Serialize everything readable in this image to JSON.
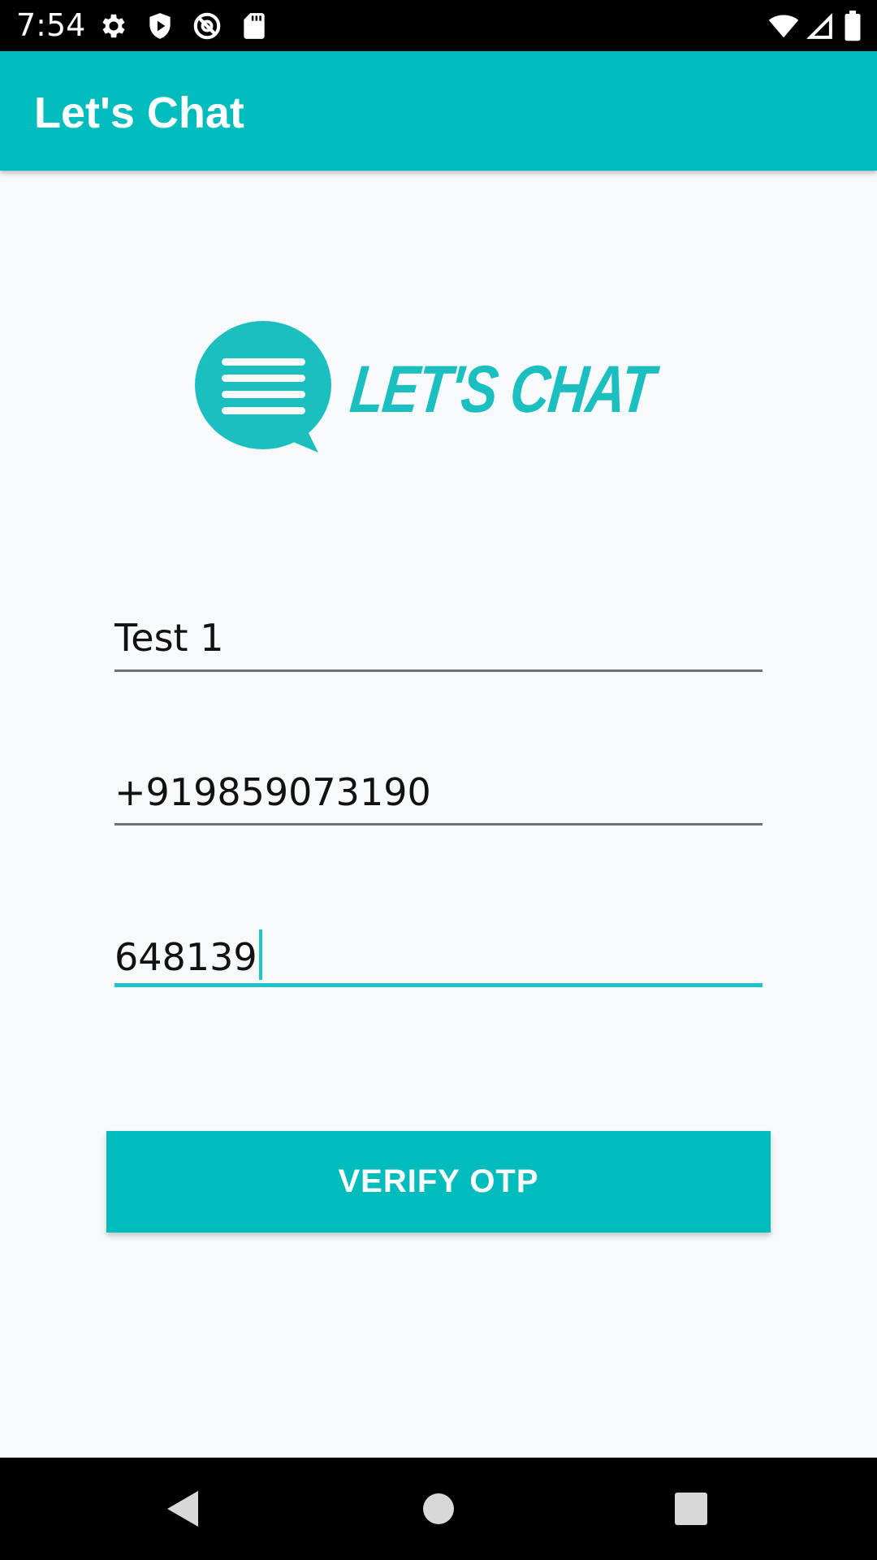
{
  "status_bar": {
    "time": "7:54",
    "left_icons": [
      "gear-icon",
      "shield-play-icon",
      "no-location-icon",
      "sd-card-icon"
    ],
    "right_icons": [
      "wifi-icon",
      "cell-signal-icon",
      "battery-icon"
    ]
  },
  "app_bar": {
    "title": "Let's Chat"
  },
  "logo": {
    "text": "LET'S CHAT",
    "color": "#1cbfc0"
  },
  "form": {
    "name_value": "Test 1",
    "phone_value": "+919859073190",
    "otp_value": "648139",
    "verify_button_label": "VERIFY OTP"
  },
  "nav_bar": {
    "icons": [
      "back-icon",
      "home-icon",
      "recents-icon"
    ]
  },
  "colors": {
    "primary": "#00bcbd",
    "accent": "#1ec5c6",
    "background": "#f8f9fa"
  }
}
